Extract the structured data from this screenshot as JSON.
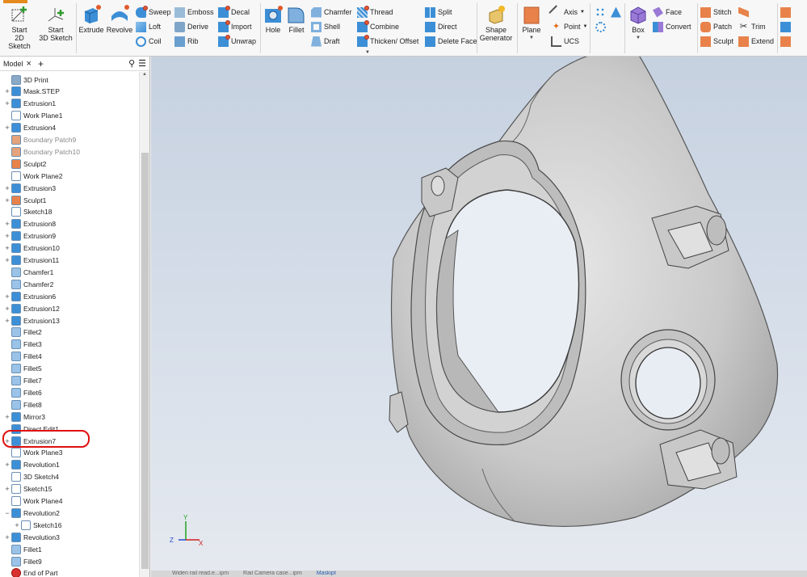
{
  "ribbon": {
    "sketch": {
      "start_2d": "Start\n2D Sketch",
      "start_3d": "Start\n3D Sketch"
    },
    "create": {
      "extrude": "Extrude",
      "revolve": "Revolve",
      "sweep": "Sweep",
      "loft": "Loft",
      "coil": "Coil",
      "emboss": "Emboss",
      "derive": "Derive",
      "rib": "Rib",
      "decal": "Decal",
      "import": "Import",
      "unwrap": "Unwrap"
    },
    "modify": {
      "hole": "Hole",
      "fillet": "Fillet",
      "chamfer": "Chamfer",
      "shell": "Shell",
      "draft": "Draft",
      "thread": "Thread",
      "combine": "Combine",
      "thicken": "Thicken/ Offset",
      "split": "Split",
      "direct": "Direct",
      "delete_face": "Delete Face"
    },
    "explore": {
      "shape_generator": "Shape\nGenerator"
    },
    "work_features": {
      "plane": "Plane",
      "axis": "Axis",
      "point": "Point",
      "ucs": "UCS"
    },
    "primitives": {
      "box": "Box"
    },
    "freeform": {
      "face": "Face",
      "convert": "Convert"
    },
    "surface": {
      "stitch": "Stitch",
      "patch": "Patch",
      "sculpt": "Sculpt",
      "trim": "Trim",
      "extend": "Extend"
    }
  },
  "panel": {
    "tab_label": "Model",
    "close": "×",
    "add": "+",
    "tree": [
      {
        "label": "3D Print",
        "pm": "",
        "icon": "print",
        "dim": false
      },
      {
        "label": "Mask.STEP",
        "pm": "+",
        "icon": "body",
        "dim": false
      },
      {
        "label": "Extrusion1",
        "pm": "+",
        "icon": "extrude",
        "dim": false
      },
      {
        "label": "Work Plane1",
        "pm": "",
        "icon": "plane",
        "dim": false
      },
      {
        "label": "Extrusion4",
        "pm": "+",
        "icon": "extrude",
        "dim": false
      },
      {
        "label": "Boundary Patch9",
        "pm": "",
        "icon": "patch",
        "dim": true
      },
      {
        "label": "Boundary Patch10",
        "pm": "",
        "icon": "patch",
        "dim": true
      },
      {
        "label": "Sculpt2",
        "pm": "",
        "icon": "sculpt",
        "dim": false
      },
      {
        "label": "Work Plane2",
        "pm": "",
        "icon": "plane",
        "dim": false
      },
      {
        "label": "Extrusion3",
        "pm": "+",
        "icon": "extrude",
        "dim": false
      },
      {
        "label": "Sculpt1",
        "pm": "+",
        "icon": "sculpt",
        "dim": false
      },
      {
        "label": "Sketch18",
        "pm": "",
        "icon": "sketch",
        "dim": false
      },
      {
        "label": "Extrusion8",
        "pm": "+",
        "icon": "extrude",
        "dim": false
      },
      {
        "label": "Extrusion9",
        "pm": "+",
        "icon": "extrude",
        "dim": false
      },
      {
        "label": "Extrusion10",
        "pm": "+",
        "icon": "extrude",
        "dim": false
      },
      {
        "label": "Extrusion11",
        "pm": "+",
        "icon": "extrude",
        "dim": false
      },
      {
        "label": "Chamfer1",
        "pm": "",
        "icon": "chamfer",
        "dim": false
      },
      {
        "label": "Chamfer2",
        "pm": "",
        "icon": "chamfer",
        "dim": false
      },
      {
        "label": "Extrusion6",
        "pm": "+",
        "icon": "extrude",
        "dim": false
      },
      {
        "label": "Extrusion12",
        "pm": "+",
        "icon": "extrude",
        "dim": false
      },
      {
        "label": "Extrusion13",
        "pm": "+",
        "icon": "extrude",
        "dim": false
      },
      {
        "label": "Fillet2",
        "pm": "",
        "icon": "fillet",
        "dim": false
      },
      {
        "label": "Fillet3",
        "pm": "",
        "icon": "fillet",
        "dim": false
      },
      {
        "label": "Fillet4",
        "pm": "",
        "icon": "fillet",
        "dim": false
      },
      {
        "label": "Fillet5",
        "pm": "",
        "icon": "fillet",
        "dim": false
      },
      {
        "label": "Fillet7",
        "pm": "",
        "icon": "fillet",
        "dim": false
      },
      {
        "label": "Fillet6",
        "pm": "",
        "icon": "fillet",
        "dim": false
      },
      {
        "label": "Fillet8",
        "pm": "",
        "icon": "fillet",
        "dim": false
      },
      {
        "label": "Mirror3",
        "pm": "+",
        "icon": "mirror",
        "dim": false
      },
      {
        "label": "Direct Edit1",
        "pm": "",
        "icon": "direct",
        "dim": false
      },
      {
        "label": "Extrusion7",
        "pm": "+",
        "icon": "extrude",
        "dim": false
      },
      {
        "label": "Work Plane3",
        "pm": "",
        "icon": "plane",
        "dim": false
      },
      {
        "label": "Revolution1",
        "pm": "+",
        "icon": "revolve",
        "dim": false
      },
      {
        "label": "3D Sketch4",
        "pm": "",
        "icon": "sketch3d",
        "dim": false
      },
      {
        "label": "Sketch15",
        "pm": "+",
        "icon": "sketch",
        "dim": false
      },
      {
        "label": "Work Plane4",
        "pm": "",
        "icon": "plane",
        "dim": false
      },
      {
        "label": "Revolution2",
        "pm": "−",
        "icon": "revolve",
        "dim": false
      },
      {
        "label": "Sketch16",
        "pm": "+",
        "icon": "sketch",
        "dim": false
      },
      {
        "label": "Revolution3",
        "pm": "+",
        "icon": "revolve",
        "dim": false
      },
      {
        "label": "Fillet1",
        "pm": "",
        "icon": "fillet",
        "dim": false
      },
      {
        "label": "Fillet9",
        "pm": "",
        "icon": "fillet",
        "dim": false
      },
      {
        "label": "End of Part",
        "pm": "",
        "icon": "end",
        "dim": false
      }
    ]
  },
  "viewport": {
    "axes": {
      "x": "X",
      "y": "Y",
      "z": "Z"
    },
    "doc_tabs": [
      "Widen rail read.e...ipm",
      "Rail Camera case...ipm",
      "Maskipt"
    ]
  },
  "colors": {
    "accent": "#e58a1f",
    "highlight": "#e01010",
    "extrude_icon": "#3c8fd6",
    "model_fill": "#c9c9c9"
  }
}
